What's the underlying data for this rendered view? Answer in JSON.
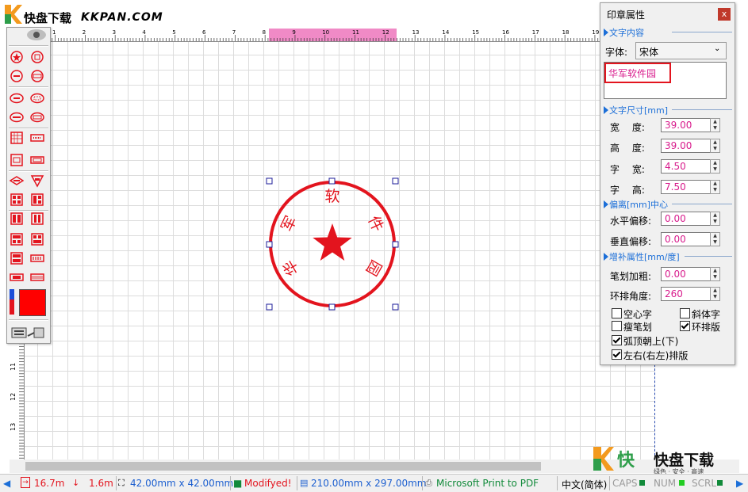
{
  "app": {
    "logo_brand": "快盘下载",
    "logo_domain": "KKPAN.COM"
  },
  "ruler": {
    "top_ticks": [
      "1",
      "2",
      "3",
      "4",
      "5",
      "6",
      "7",
      "8",
      "9",
      "10",
      "11",
      "12",
      "13",
      "14",
      "15",
      "16",
      "17",
      "18",
      "19"
    ],
    "left_ticks": [
      "11",
      "12",
      "13"
    ]
  },
  "toolbox": {
    "tools": [
      "round-seal-star-tool",
      "round-seal-square-tool",
      "round-seal-minus-tool",
      "round-seal-bar-tool",
      "oval-seal-tool",
      "oval-seal-dots-tool",
      "oval-seal-bar-tool",
      "oval-seal-plain-tool",
      "grid-seal-tool",
      "rect-bar-seal-tool",
      "rect-seal-tool",
      "rect-seal-wide-tool",
      "diamond-seal-tool",
      "triangle-seal-tool",
      "quad-seal-tool",
      "split-seal-tool",
      "double-bar-seal-tool",
      "twin-rect-seal-tool",
      "quad-grid-tool",
      "quad-grid-alt-tool",
      "half-split-tool",
      "bar-code-tool",
      "small-rect-tool",
      "wide-bar-tool"
    ],
    "fill_color": "#ff0000",
    "stroke_color": "#1c4fd8"
  },
  "stamp": {
    "color": "#e3141e",
    "ring_text": "华军软件园"
  },
  "panel": {
    "title": "印章属性",
    "close_label": "x",
    "section_text": "文字内容",
    "font_label": "字体:",
    "font_value": "宋体",
    "text_content": "华军软件园",
    "section_size": "文字尺寸[mm]",
    "width_label": "宽　 度:",
    "width_value": "39.00",
    "height_label": "高　 度:",
    "height_value": "39.00",
    "char_width_label": "字　 宽:",
    "char_width_value": "4.50",
    "char_height_label": "字　 高:",
    "char_height_value": "7.50",
    "section_offset": "偏离[mm]中心",
    "h_offset_label": "水平偏移:",
    "h_offset_value": "0.00",
    "v_offset_label": "垂直偏移:",
    "v_offset_value": "0.00",
    "section_extra": "增补属性[mm/度]",
    "stroke_label": "笔划加粗:",
    "stroke_value": "0.00",
    "angle_label": "环排角度:",
    "angle_value": "260",
    "chk_hollow": "空心字",
    "chk_italic": "斜体字",
    "chk_thin": "瘦笔划",
    "chk_ring": "环排版",
    "chk_arc_up": "弧顶朝上(下)",
    "chk_lr": "左右(右左)排版",
    "checks": {
      "hollow": false,
      "italic": false,
      "thin": false,
      "ring": true,
      "arc_up": true,
      "lr": true
    }
  },
  "status": {
    "pos_x": "16.7m",
    "pos_y": "1.6m",
    "seal_size": "42.00mm x 42.00mm",
    "modified": "Modifyed!",
    "page_size": "210.00mm x 297.00mm",
    "printer": "Microsoft Print to PDF",
    "ime": "中文(简体)",
    "caps": "CAPS",
    "num": "NUM",
    "scrl": "SCRL"
  },
  "watermark": {
    "brand": "快盘下载",
    "slogan": "绿色 · 安全 · 高速"
  }
}
